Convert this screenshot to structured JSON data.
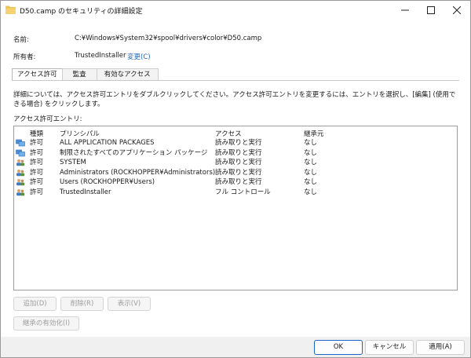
{
  "window": {
    "title": "D50.camp のセキュリティの詳細設定",
    "minimize_icon": "minimize-icon",
    "maximize_icon": "maximize-icon",
    "close_icon": "close-icon"
  },
  "info": {
    "name_label": "名前:",
    "name_value": "C:¥Windows¥System32¥spool¥drivers¥color¥D50.camp",
    "owner_label": "所有者:",
    "owner_value": "TrustedInstaller",
    "owner_change_link": "変更(C)"
  },
  "tabs": [
    {
      "label": "アクセス許可",
      "active": true
    },
    {
      "label": "監査",
      "active": false
    },
    {
      "label": "有効なアクセス",
      "active": false
    }
  ],
  "description": "詳細については、アクセス許可エントリをダブルクリックしてください。アクセス許可エントリを変更するには、エントリを選択し、[編集] (使用できる場合) をクリックします。",
  "entries_label": "アクセス許可エントリ:",
  "table": {
    "headers": {
      "type": "種類",
      "principal": "プリンシパル",
      "access": "アクセス",
      "inherited": "継承元"
    },
    "rows": [
      {
        "icon": "group-icon",
        "type": "許可",
        "principal": "ALL APPLICATION PACKAGES",
        "access": "読み取りと実行",
        "inherited": "なし"
      },
      {
        "icon": "group-icon",
        "type": "許可",
        "principal": "制限されたすべてのアプリケーション パッケージ",
        "access": "読み取りと実行",
        "inherited": "なし"
      },
      {
        "icon": "users-icon",
        "type": "許可",
        "principal": "SYSTEM",
        "access": "読み取りと実行",
        "inherited": "なし"
      },
      {
        "icon": "users-icon",
        "type": "許可",
        "principal": "Administrators (ROCKHOPPER¥Administrators)",
        "access": "読み取りと実行",
        "inherited": "なし"
      },
      {
        "icon": "users-icon",
        "type": "許可",
        "principal": "Users (ROCKHOPPER¥Users)",
        "access": "読み取りと実行",
        "inherited": "なし"
      },
      {
        "icon": "users-icon",
        "type": "許可",
        "principal": "TrustedInstaller",
        "access": "フル コントロール",
        "inherited": "なし"
      }
    ]
  },
  "actions": {
    "add": "追加(D)",
    "remove": "削除(R)",
    "view": "表示(V)",
    "inheritance": "継承の有効化(I)"
  },
  "footer": {
    "ok": "OK",
    "cancel": "キャンセル",
    "apply": "適用(A)"
  },
  "colors": {
    "accent": "#1a66c7",
    "folder": "#f2c14e"
  }
}
